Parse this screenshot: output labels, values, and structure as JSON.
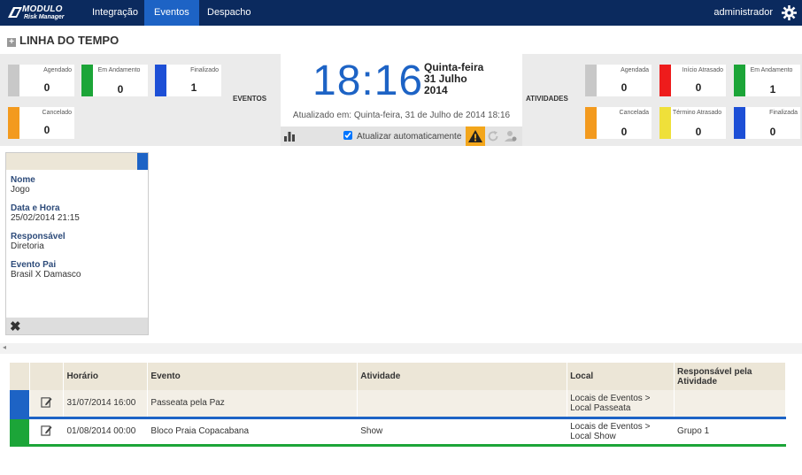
{
  "app": {
    "logo_line1": "MODULO",
    "logo_line2": "Risk Manager",
    "user": "administrador"
  },
  "nav": [
    {
      "label": "Integração",
      "active": false
    },
    {
      "label": "Eventos",
      "active": true
    },
    {
      "label": "Despacho",
      "active": false
    }
  ],
  "page": {
    "title": "LINHA DO TEMPO"
  },
  "eventos": {
    "section_label": "EVENTOS",
    "cards": [
      {
        "label": "Agendado",
        "value": "0",
        "color": "#c8c8c8"
      },
      {
        "label": "Em Andamento",
        "value": "0",
        "color": "#1ca538"
      },
      {
        "label": "Finalizado",
        "value": "1",
        "color": "#1d4fd6"
      },
      {
        "label": "Cancelado",
        "value": "0",
        "color": "#f39a1e"
      }
    ]
  },
  "clock": {
    "time": "18:16",
    "weekday": "Quinta-feira",
    "date": "31 Julho",
    "year": "2014",
    "updated": "Atualizado em: Quinta-feira, 31 de Julho de 2014 18:16",
    "auto_update_label": "Atualizar automaticamente",
    "auto_update_checked": true
  },
  "atividades": {
    "section_label": "ATIVIDADES",
    "cards": [
      {
        "label": "Agendada",
        "value": "0",
        "color": "#c8c8c8"
      },
      {
        "label": "Início Atrasado",
        "value": "0",
        "color": "#ee1c1c"
      },
      {
        "label": "Em Andamento",
        "value": "1",
        "color": "#1ca538"
      },
      {
        "label": "Cancelada",
        "value": "0",
        "color": "#f39a1e"
      },
      {
        "label": "Término Atrasado",
        "value": "0",
        "color": "#efe03a"
      },
      {
        "label": "Finalizada",
        "value": "0",
        "color": "#1d4fd6"
      }
    ]
  },
  "detail": {
    "fields": [
      {
        "key": "Nome",
        "value": "Jogo"
      },
      {
        "key": "Data e Hora",
        "value": "25/02/2014 21:15"
      },
      {
        "key": "Responsável",
        "value": "Diretoria"
      },
      {
        "key": "Evento Pai",
        "value": "Brasil X Damasco"
      }
    ]
  },
  "table": {
    "headers": [
      "",
      "",
      "Horário",
      "Evento",
      "Atividade",
      "Local",
      "Responsável pela Atividade"
    ],
    "rows": [
      {
        "color": "#1d63c5",
        "horario": "31/07/2014 16:00",
        "evento": "Passeata pela Paz",
        "atividade": "",
        "local": "Locais de Eventos > Local Passeata",
        "responsavel": ""
      },
      {
        "color": "#1ca538",
        "horario": "01/08/2014 00:00",
        "evento": "Bloco Praia Copacabana",
        "atividade": "Show",
        "local": "Locais de Eventos > Local Show",
        "responsavel": "Grupo 1"
      }
    ]
  }
}
